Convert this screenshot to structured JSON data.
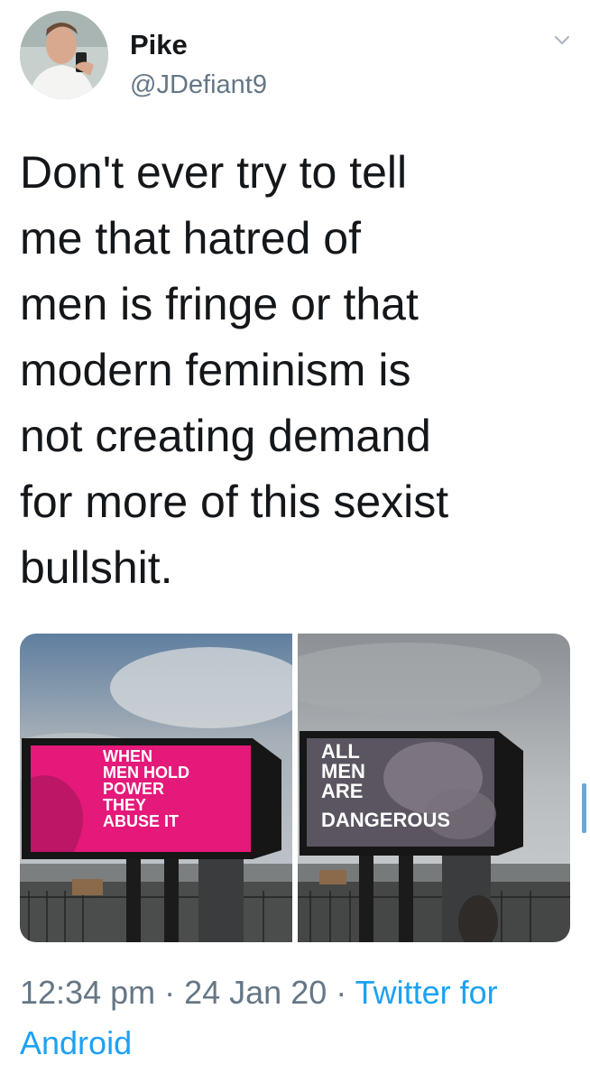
{
  "user": {
    "display_name": "Pike",
    "handle": "@JDefiant9"
  },
  "tweet": {
    "text_lines": [
      "Don't ever try to tell",
      "me that hatred of",
      "men is fringe or that",
      "modern feminism is",
      "not creating demand",
      "for more of this sexist",
      "bullshit."
    ]
  },
  "media": {
    "photos": [
      {
        "billboard_text": [
          "WHEN",
          "MEN HOLD",
          "POWER",
          "THEY",
          "ABUSE IT"
        ],
        "billboard_color": "#e5197a"
      },
      {
        "billboard_text": [
          "ALL",
          "MEN",
          "ARE",
          "DANGEROUS"
        ],
        "billboard_color": "#5a5560"
      }
    ]
  },
  "meta": {
    "time": "12:34 pm",
    "separator": " · ",
    "date": "24 Jan 20",
    "source": "Twitter for Android"
  },
  "colors": {
    "link_blue": "#1da1f2",
    "secondary_gray": "#657786",
    "text": "#14171a"
  },
  "icons": {
    "chevron": "chevron-down-icon"
  }
}
